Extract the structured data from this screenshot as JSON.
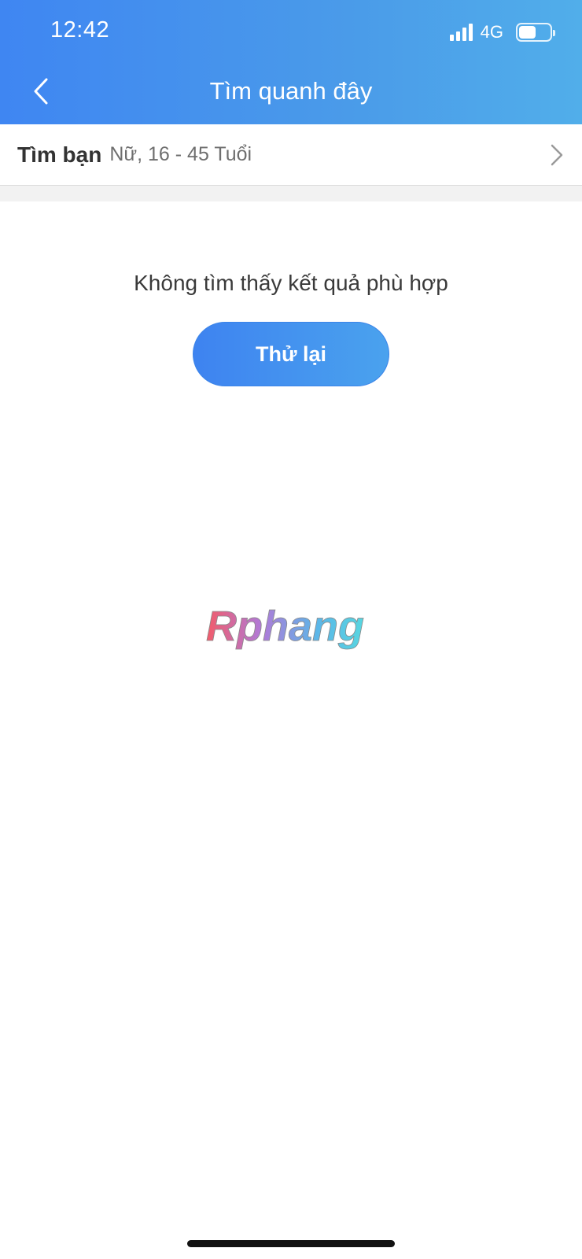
{
  "status_bar": {
    "time": "12:42",
    "network": "4G",
    "signal_bars": 4,
    "battery_level": 0.55
  },
  "header": {
    "title": "Tìm quanh đây",
    "back_icon": "chevron-left-icon",
    "gradient_start": "#3f86f2",
    "gradient_end": "#51aeea"
  },
  "filter": {
    "label": "Tìm bạn",
    "value": "Nữ, 16 - 45 Tuổi",
    "icon": "chevron-right-icon"
  },
  "empty_state": {
    "message": "Không tìm thấy kết quả phù hợp",
    "retry_label": "Thử lại"
  },
  "watermark": {
    "text": "Rphang"
  },
  "colors": {
    "accent": "#3e83f0",
    "text_primary": "#333333",
    "text_secondary": "#6e6e6e"
  }
}
